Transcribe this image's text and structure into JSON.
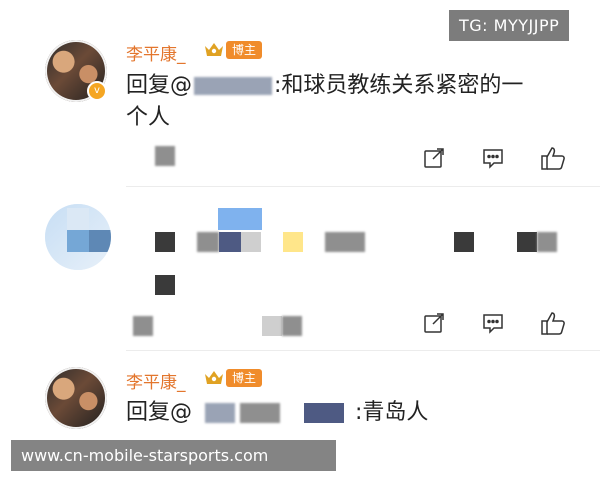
{
  "overlay": {
    "tg_label": "TG: MYYJJPP",
    "watermark": "www.cn-mobile-starsports.com"
  },
  "comments": [
    {
      "username": "李平康_",
      "badge": "博主",
      "text_line1": "回复@",
      "text_line1_tail": ":和球员教练关系紧密的一",
      "text_line2": "个人",
      "actions": [
        "share-icon",
        "comment-icon",
        "like-icon"
      ]
    },
    {
      "username": "",
      "actions": [
        "share-icon",
        "comment-icon",
        "like-icon"
      ]
    },
    {
      "username": "李平康_",
      "badge": "博主",
      "text_prefix": "回复@",
      "text_tail": ":青岛人"
    }
  ],
  "colors": {
    "username": "#e3762d",
    "badge_bg": "#f08c2b",
    "crown": "#e0a223",
    "verified": "#f5a623"
  }
}
